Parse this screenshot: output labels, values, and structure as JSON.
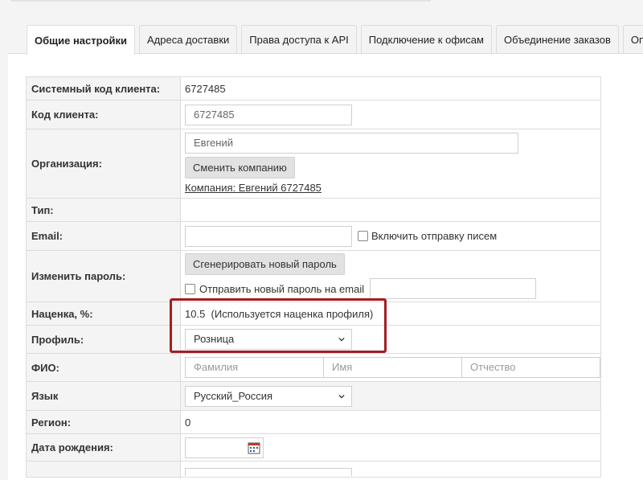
{
  "tabs": [
    {
      "label": "Общие настройки",
      "active": true
    },
    {
      "label": "Адреса доставки"
    },
    {
      "label": "Права доступа к API"
    },
    {
      "label": "Подключение к офисам"
    },
    {
      "label": "Объединение заказов"
    },
    {
      "label": "Опции"
    }
  ],
  "form": {
    "system_code": {
      "label": "Системный код клиента:",
      "value": "6727485"
    },
    "client_code": {
      "label": "Код клиента:",
      "value": "6727485"
    },
    "organization": {
      "label": "Организация:",
      "value": "Евгений",
      "change_button": "Сменить компанию",
      "company_link": "Компания: Евгений 6727485"
    },
    "type": {
      "label": "Тип:"
    },
    "email": {
      "label": "Email:",
      "value": "",
      "enable_mail_label": "Включить отправку писем"
    },
    "password": {
      "label": "Изменить пароль:",
      "generate_button": "Сгенерировать новый пароль",
      "send_label": "Отправить новый пароль на email",
      "value": ""
    },
    "markup": {
      "label": "Наценка, %:",
      "value": "10.5  (Используется наценка профиля)"
    },
    "profile": {
      "label": "Профиль:",
      "value": "Розница"
    },
    "fio": {
      "label": "ФИО:",
      "last_name_placeholder": "Фамилия",
      "first_name_placeholder": "Имя",
      "patronymic_placeholder": "Отчество"
    },
    "language": {
      "label": "Язык",
      "value": "Русский_Россия"
    },
    "region": {
      "label": "Регион:",
      "value": "0"
    },
    "birthdate": {
      "label": "Дата рождения:",
      "value": ""
    }
  },
  "highlight_color": "#a51d20"
}
